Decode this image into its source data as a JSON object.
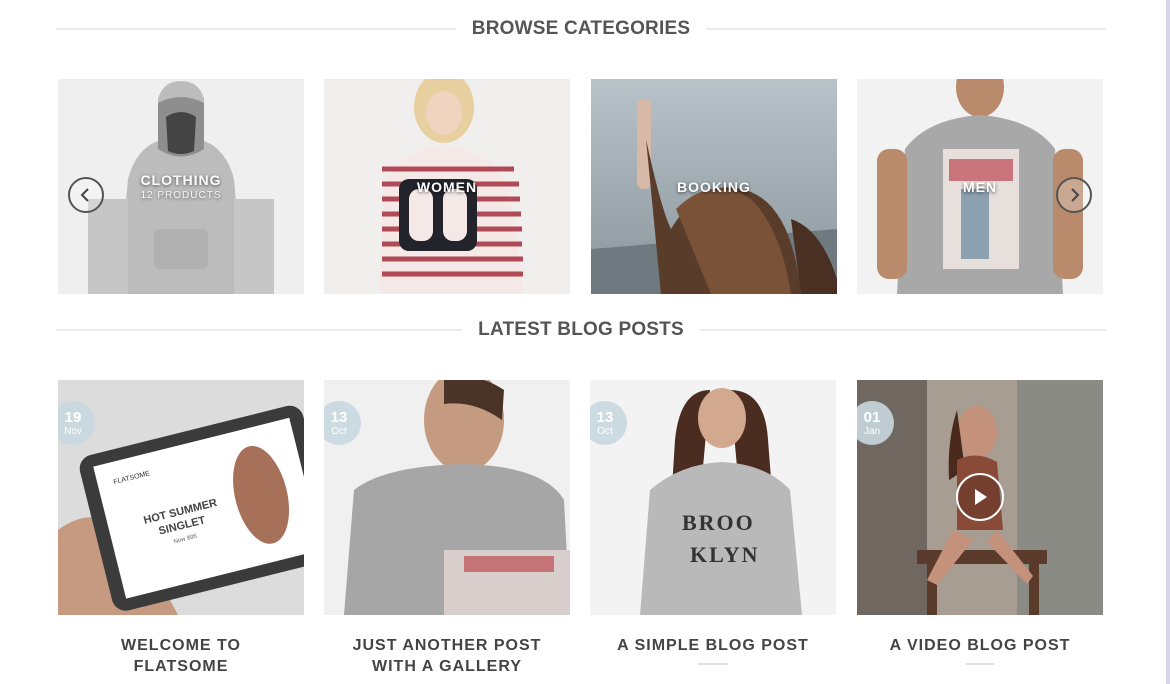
{
  "sections": {
    "browse_title": "BROWSE CATEGORIES",
    "blog_title": "LATEST BLOG POSTS"
  },
  "categories": [
    {
      "name": "CLOTHING",
      "count": "12 PRODUCTS"
    },
    {
      "name": "WOMEN",
      "count": ""
    },
    {
      "name": "BOOKING",
      "count": ""
    },
    {
      "name": "MEN",
      "count": ""
    }
  ],
  "carousel": {
    "prev_icon": "chevron-left-icon",
    "next_icon": "chevron-right-icon"
  },
  "posts": [
    {
      "day": "19",
      "month": "Nov",
      "title": "WELCOME TO FLATSOME",
      "image": "tablet-shop"
    },
    {
      "day": "13",
      "month": "Oct",
      "title": "JUST ANOTHER POST WITH A GALLERY",
      "image": "man-tshirt"
    },
    {
      "day": "13",
      "month": "Oct",
      "title": "A SIMPLE BLOG POST",
      "image": "woman-brooklyn"
    },
    {
      "day": "01",
      "month": "Jan",
      "title": "A VIDEO BLOG POST",
      "image": "woman-table-video",
      "play_icon": "play-icon"
    }
  ],
  "tablet_screen": {
    "brand": "FLATSOME",
    "headline_1": "HOT SUMMER",
    "headline_2": "SINGLET",
    "price": "Now $95"
  },
  "colors": {
    "title_text": "#555555",
    "date_badge": "#c8d8df",
    "divider": "#ececec"
  }
}
